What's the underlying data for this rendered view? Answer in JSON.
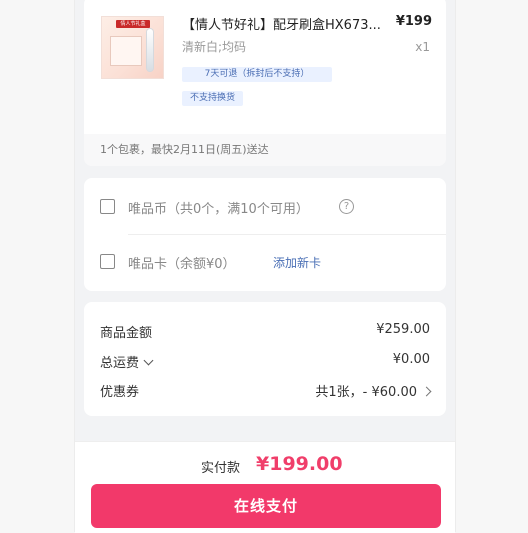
{
  "product": {
    "title": "【情人节好礼】配牙刷盒HX673...",
    "price": "¥199",
    "spec": "清新白;均码",
    "quantity": "x1",
    "tags": [
      "7天可退（拆封后不支持）",
      "不支持换货"
    ],
    "thumb": {
      "badge": "情人节礼盒"
    }
  },
  "shipping_note": "1个包裹，最快2月11日(周五)送达",
  "options": {
    "coin": {
      "label": "唯品币（共0个，满10个可用）",
      "help_icon": "?"
    },
    "card": {
      "label": "唯品卡（余额¥0）",
      "add_link": "添加新卡"
    }
  },
  "summary": {
    "goods_amount": {
      "label": "商品金额",
      "value": "¥259.00"
    },
    "shipping_fee": {
      "label": "总运费",
      "value": "¥0.00"
    },
    "coupon": {
      "label": "优惠券",
      "value": "共1张，- ¥60.00"
    }
  },
  "footer": {
    "pay_label": "实付款",
    "pay_amount": "¥199.00",
    "pay_button": "在线支付"
  },
  "colors": {
    "accent": "#f2396a",
    "link": "#4a6fb5",
    "tag_bg": "#eaf1ff"
  }
}
